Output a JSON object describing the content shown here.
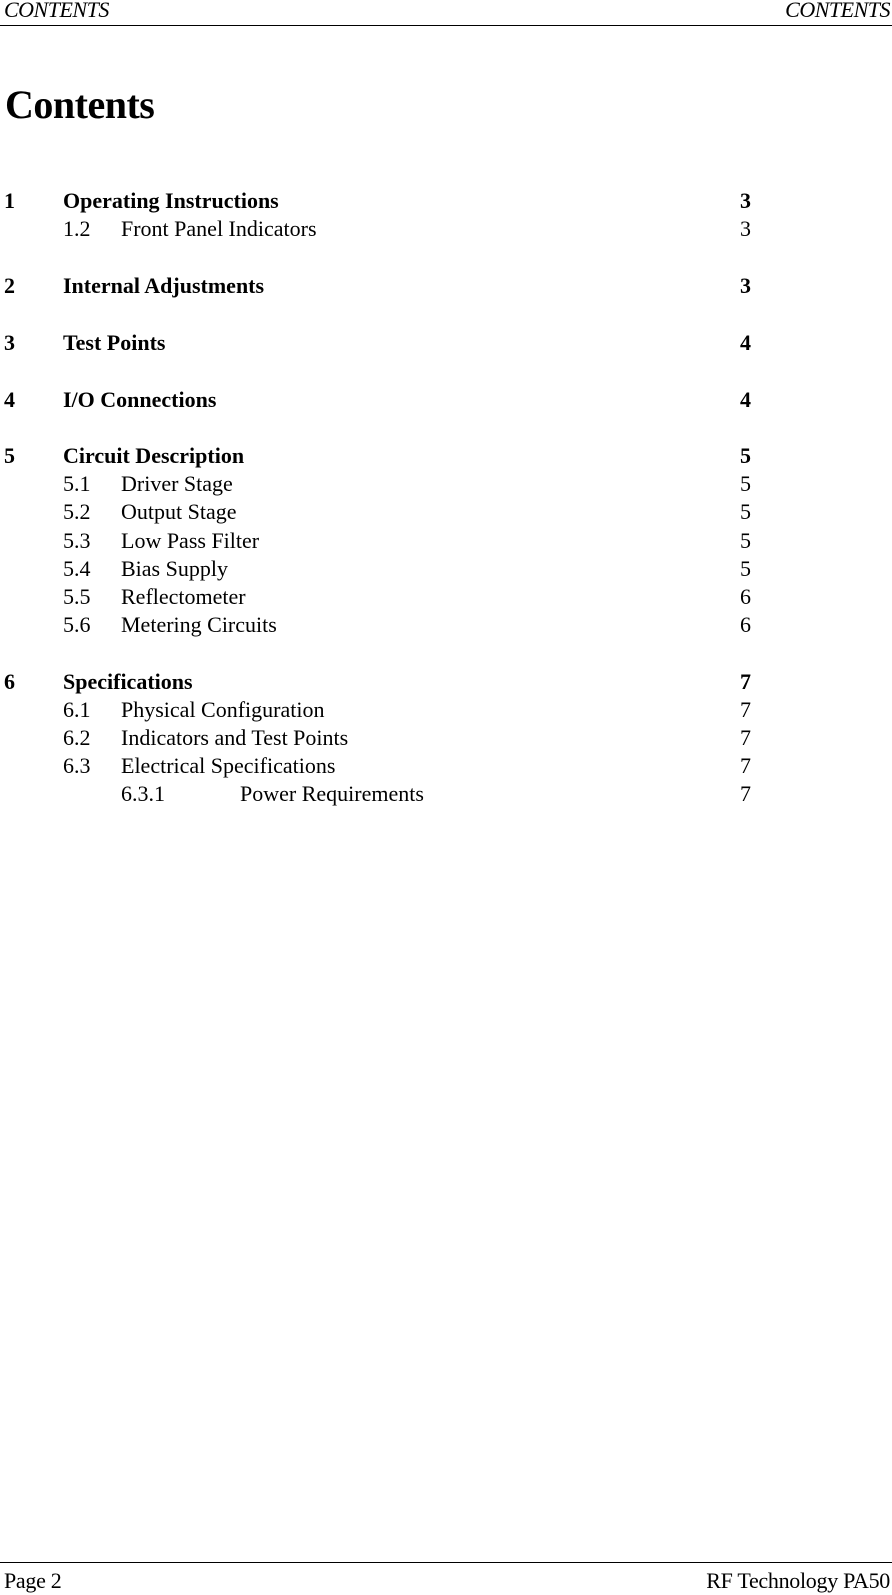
{
  "header": {
    "left": "CONTENTS",
    "right": "CONTENTS"
  },
  "title": "Contents",
  "toc": [
    {
      "level": 1,
      "number": "1",
      "title": "Operating Instructions",
      "page": "3"
    },
    {
      "level": 2,
      "number": "1.2",
      "title": "Front Panel Indicators",
      "page": "3"
    },
    {
      "level": 1,
      "number": "2",
      "title": "Internal Adjustments",
      "page": "3"
    },
    {
      "level": 1,
      "number": "3",
      "title": "Test Points",
      "page": "4"
    },
    {
      "level": 1,
      "number": "4",
      "title": "I/O Connections",
      "page": "4"
    },
    {
      "level": 1,
      "number": "5",
      "title": "Circuit Description",
      "page": "5"
    },
    {
      "level": 2,
      "number": "5.1",
      "title": "Driver Stage",
      "page": "5"
    },
    {
      "level": 2,
      "number": "5.2",
      "title": "Output Stage",
      "page": "5"
    },
    {
      "level": 2,
      "number": "5.3",
      "title": "Low Pass Filter",
      "page": "5"
    },
    {
      "level": 2,
      "number": "5.4",
      "title": "Bias Supply",
      "page": "5"
    },
    {
      "level": 2,
      "number": "5.5",
      "title": "Reflectometer",
      "page": "6"
    },
    {
      "level": 2,
      "number": "5.6",
      "title": "Metering Circuits",
      "page": "6"
    },
    {
      "level": 1,
      "number": "6",
      "title": "Specifications",
      "page": "7"
    },
    {
      "level": 2,
      "number": "6.1",
      "title": "Physical Configuration",
      "page": "7"
    },
    {
      "level": 2,
      "number": "6.2",
      "title": "Indicators and Test Points",
      "page": "7"
    },
    {
      "level": 2,
      "number": "6.3",
      "title": "Electrical Specifications",
      "page": "7"
    },
    {
      "level": 3,
      "number": "6.3.1",
      "title": "Power Requirements",
      "page": "7"
    }
  ],
  "footer": {
    "left": "Page 2",
    "right": "RF Technology PA50"
  }
}
